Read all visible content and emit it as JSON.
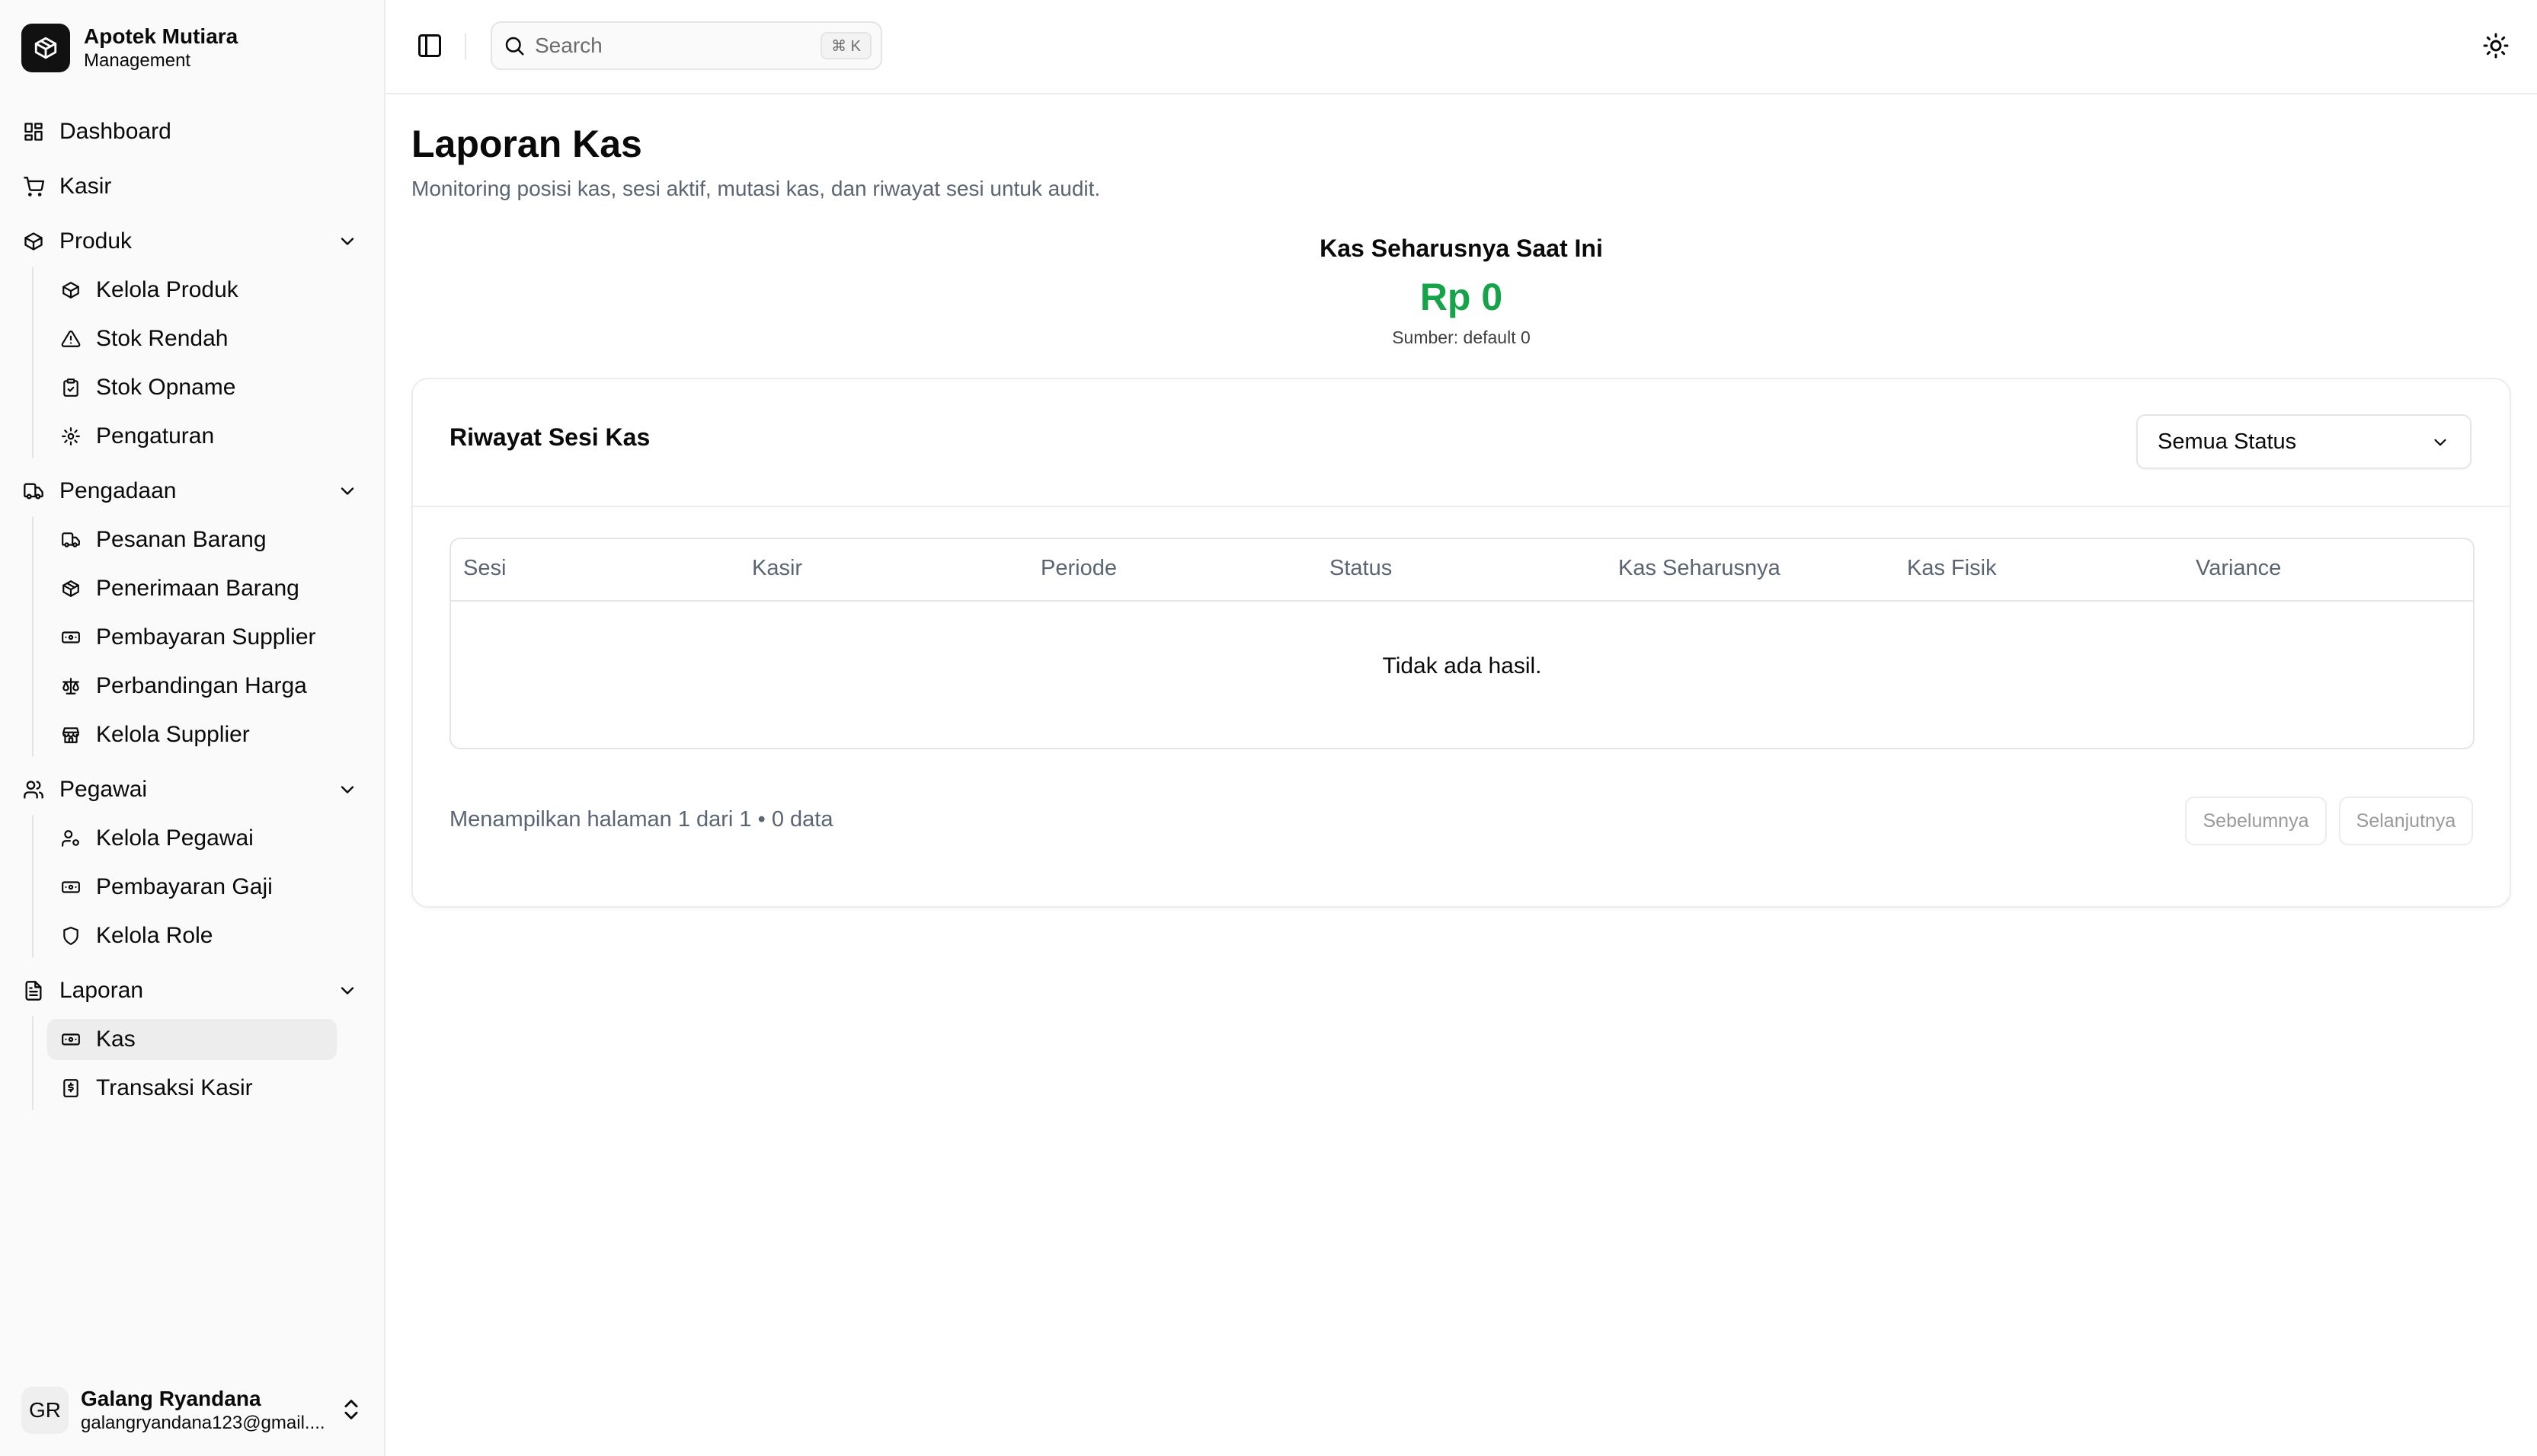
{
  "app": {
    "name": "Apotek Mutiara",
    "subtitle": "Management"
  },
  "header": {
    "search_placeholder": "Search",
    "search_shortcut": "⌘ K"
  },
  "sidebar": {
    "dashboard": "Dashboard",
    "kasir": "Kasir",
    "produk": {
      "label": "Produk",
      "items": [
        "Kelola Produk",
        "Stok Rendah",
        "Stok Opname",
        "Pengaturan"
      ]
    },
    "pengadaan": {
      "label": "Pengadaan",
      "items": [
        "Pesanan Barang",
        "Penerimaan Barang",
        "Pembayaran Supplier",
        "Perbandingan Harga",
        "Kelola Supplier"
      ]
    },
    "pegawai": {
      "label": "Pegawai",
      "items": [
        "Kelola Pegawai",
        "Pembayaran Gaji",
        "Kelola Role"
      ]
    },
    "laporan": {
      "label": "Laporan",
      "items": [
        "Kas",
        "Transaksi Kasir"
      ],
      "active": "Kas"
    }
  },
  "user": {
    "initials": "GR",
    "name": "Galang Ryandana",
    "email": "galangryandana123@gmail...."
  },
  "page": {
    "title": "Laporan Kas",
    "description": "Monitoring posisi kas, sesi aktif, mutasi kas, dan riwayat sesi untuk audit."
  },
  "kas": {
    "label": "Kas Seharusnya Saat Ini",
    "value": "Rp 0",
    "source": "Sumber: default 0",
    "value_color": "#16a34a"
  },
  "riwayat": {
    "title": "Riwayat Sesi Kas",
    "filter_value": "Semua Status",
    "columns": [
      "Sesi",
      "Kasir",
      "Periode",
      "Status",
      "Kas Seharusnya",
      "Kas Fisik",
      "Variance"
    ],
    "empty_text": "Tidak ada hasil.",
    "pagination_text": "Menampilkan halaman 1 dari 1 • 0 data",
    "prev_label": "Sebelumnya",
    "next_label": "Selanjutnya"
  }
}
